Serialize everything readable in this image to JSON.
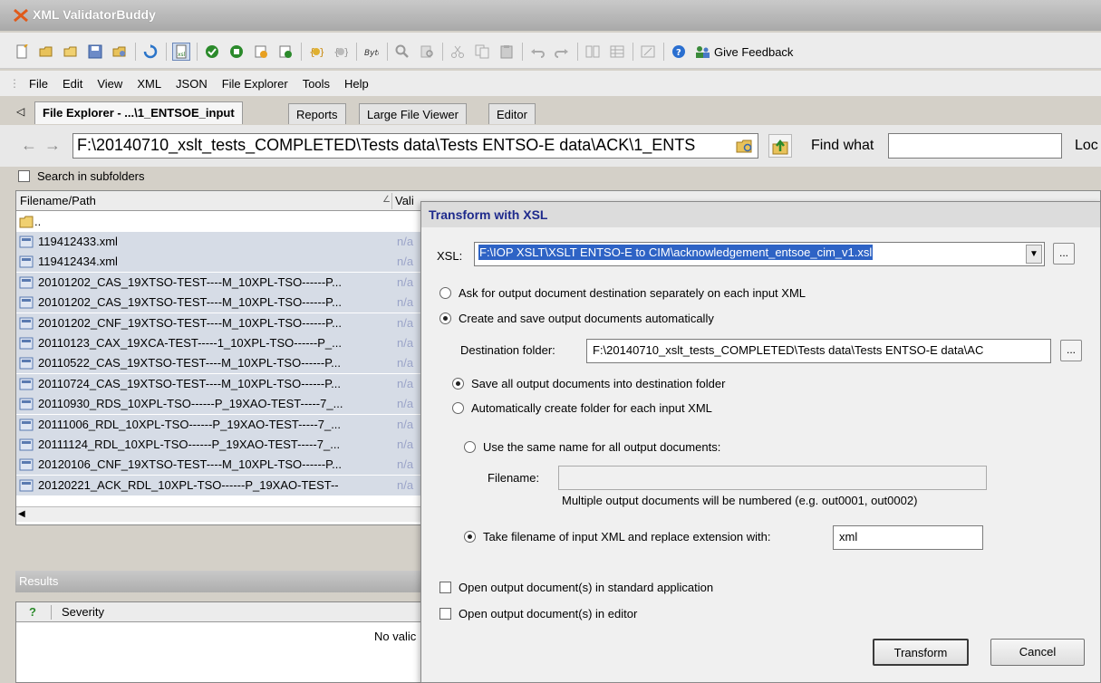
{
  "window": {
    "title": "XML ValidatorBuddy"
  },
  "toolbar": {
    "feedback_label": "Give Feedback"
  },
  "menu": [
    "File",
    "Edit",
    "View",
    "XML",
    "JSON",
    "File Explorer",
    "Tools",
    "Help"
  ],
  "tabs": [
    {
      "label": "File Explorer - ...\\1_ENTSOE_input",
      "active": true
    },
    {
      "label": "Reports",
      "active": false
    },
    {
      "label": "Large File Viewer",
      "active": false
    },
    {
      "label": "Editor",
      "active": false
    }
  ],
  "path": {
    "value": "F:\\20140710_xslt_tests_COMPLETED\\Tests data\\Tests ENTSO-E data\\ACK\\1_ENTS",
    "find_label": "Find what",
    "find_value": "",
    "look_in_label": "Loc"
  },
  "subfolders": {
    "label": "Search in subfolders",
    "checked": false
  },
  "file_list": {
    "columns": {
      "name": "Filename/Path",
      "valid": "Vali"
    },
    "parent": "..",
    "files": [
      {
        "name": "119412433.xml",
        "valid": "n/a"
      },
      {
        "name": "119412434.xml",
        "valid": "n/a"
      },
      {
        "name": "20101202_CAS_19XTSO-TEST----M_10XPL-TSO------P...",
        "valid": "n/a"
      },
      {
        "name": "20101202_CAS_19XTSO-TEST----M_10XPL-TSO------P...",
        "valid": "n/a"
      },
      {
        "name": "20101202_CNF_19XTSO-TEST----M_10XPL-TSO------P...",
        "valid": "n/a"
      },
      {
        "name": "20110123_CAX_19XCA-TEST-----1_10XPL-TSO------P_...",
        "valid": "n/a"
      },
      {
        "name": "20110522_CAS_19XTSO-TEST----M_10XPL-TSO------P...",
        "valid": "n/a"
      },
      {
        "name": "20110724_CAS_19XTSO-TEST----M_10XPL-TSO------P...",
        "valid": "n/a"
      },
      {
        "name": "20110930_RDS_10XPL-TSO------P_19XAO-TEST-----7_...",
        "valid": "n/a"
      },
      {
        "name": "20111006_RDL_10XPL-TSO------P_19XAO-TEST-----7_...",
        "valid": "n/a"
      },
      {
        "name": "20111124_RDL_10XPL-TSO------P_19XAO-TEST-----7_...",
        "valid": "n/a"
      },
      {
        "name": "20120106_CNF_19XTSO-TEST----M_10XPL-TSO------P...",
        "valid": "n/a"
      },
      {
        "name": "20120221_ACK_RDL_10XPL-TSO------P_19XAO-TEST--",
        "valid": "n/a"
      }
    ]
  },
  "results": {
    "title": "Results",
    "col_q": "?",
    "col_severity": "Severity",
    "empty_text": "No valic"
  },
  "dialog": {
    "title": "Transform with XSL",
    "xsl_label": "XSL:",
    "xsl_value": "F:\\IOP XSLT\\XSLT ENTSO-E to CIM\\acknowledgement_entsoe_cim_v1.xsl",
    "browse": "...",
    "opt_ask": "Ask for output document destination separately on each input XML",
    "opt_auto": "Create and save output documents automatically",
    "dest_label": "Destination folder:",
    "dest_value": "F:\\20140710_xslt_tests_COMPLETED\\Tests data\\Tests ENTSO-E data\\AC",
    "opt_save_all": "Save all output documents into destination folder",
    "opt_create_folder": "Automatically create folder for each input XML",
    "opt_same_name": "Use the same name for all output documents:",
    "filename_label": "Filename:",
    "filename_value": "",
    "numbered_hint": "Multiple output documents will be numbered (e.g. out0001, out0002)",
    "opt_take_filename": "Take filename of input XML and replace extension with:",
    "extension_value": "xml",
    "open_standard": "Open output document(s) in standard application",
    "open_editor": "Open output document(s) in editor",
    "transform_button": "Transform",
    "cancel_button": "Cancel"
  }
}
